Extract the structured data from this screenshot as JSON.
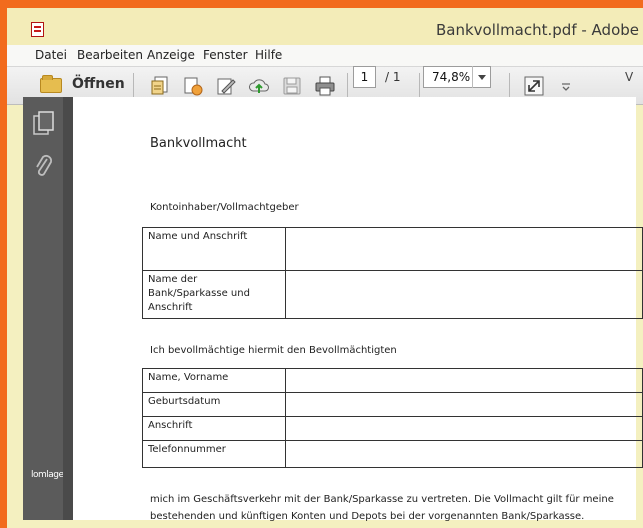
{
  "window": {
    "title": "Bankvollmacht.pdf - Adobe Re"
  },
  "menu": [
    "Datei",
    "Bearbeiten",
    "Anzeige",
    "Fenster",
    "Hilfe"
  ],
  "toolbar": {
    "open_label": "Öffnen",
    "page_current": "1",
    "page_total": "/ 1",
    "zoom": "74,8%",
    "trailing_label": "V"
  },
  "sidebar": {
    "label": "lomlage"
  },
  "document": {
    "title": "Bankvollmacht",
    "section1_heading": "Kontoinhaber/Vollmachtgeber",
    "table1": [
      "Name und Anschrift",
      [
        "Name der",
        "Bank/Sparkasse und",
        "Anschrift"
      ]
    ],
    "section2_heading": "Ich bevollmächtige hiermit den Bevollmächtigten",
    "table2": [
      "Name, Vorname",
      "Geburtsdatum",
      "Anschrift",
      "Telefonnummer"
    ],
    "body_line1": "mich im Geschäftsverkehr mit der Bank/Sparkasse zu vertreten. Die Vollmacht gilt für meine",
    "body_line2": "bestehenden und künftigen Konten und Depots bei der vorgenannten Bank/Sparkasse."
  },
  "colors": {
    "background_border": "#f26b1d",
    "sidebar": "#5b5b5b",
    "canvas": "#4a4a4a"
  },
  "icons": [
    "pdf-app-icon",
    "open-folder-icon",
    "create-pdf-icon",
    "combine-icon",
    "edit-icon",
    "cloud-upload-icon",
    "save-icon",
    "print-icon",
    "fit-page-icon",
    "dropdown-icon",
    "pages-panel-icon",
    "attachment-icon"
  ]
}
